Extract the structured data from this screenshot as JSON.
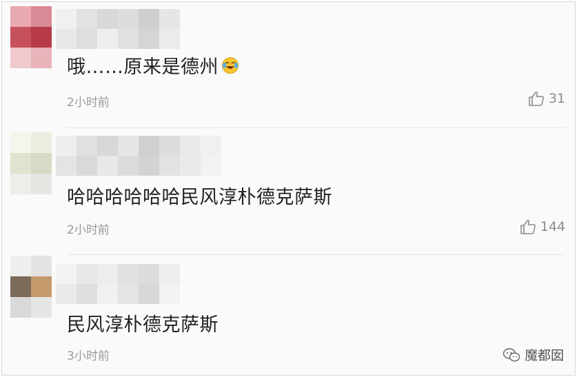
{
  "comments": [
    {
      "text": "哦……原来是德州",
      "emoji": "laughing-crying-emoji",
      "time": "2小时前",
      "likes": "31",
      "avatar_colors": [
        "#e9a9b0",
        "#d98a95",
        "#c6505c",
        "#b73a48",
        "#f0c9cd",
        "#e8b4ba"
      ],
      "username_colors": [
        [
          "#f0f0f0",
          "#e2e2e2",
          "#d8d8d8",
          "#dddddd",
          "#cfcfcf",
          "#e6e6e6"
        ],
        [
          "#e8e8e8",
          "#dedede",
          "#eeeeee",
          "#e0e0e0",
          "#d5d5d5",
          "#ebebeb"
        ]
      ]
    },
    {
      "text": "哈哈哈哈哈哈民风淳朴德克萨斯",
      "time": "2小时前",
      "likes": "144",
      "avatar_colors": [
        "#f4f5ec",
        "#eaeee0",
        "#dfe3cf",
        "#d5dbc4",
        "#eceeea",
        "#e4e6e2"
      ],
      "username_colors": [
        [
          "#eeeeee",
          "#e0e0e0",
          "#d7d7d7",
          "#e6e6e6",
          "#d0d0d0",
          "#dddddd",
          "#e9e9e9",
          "#f0f0f0"
        ],
        [
          "#e4e4e4",
          "#d9d9d9",
          "#e8e8e8",
          "#dcdcdc",
          "#d3d3d3",
          "#e2e2e2",
          "#eaeaea",
          "#f2f2f2"
        ]
      ]
    },
    {
      "text": "民风淳朴德克萨斯",
      "time": "3小时前",
      "avatar_colors": [
        "#efefef",
        "#e3e3e3",
        "#7c6a5a",
        "#c49a6c",
        "#d9d9d9",
        "#e6e6e6"
      ],
      "username_colors": [
        [
          "#f3f3f3",
          "#e8e8e8",
          "#ededed",
          "#e1e1e1",
          "#dcdcdc",
          "#eeeeee"
        ],
        [
          "#eaeaea",
          "#dfdfdf",
          "#f0f0f0",
          "#e4e4e4",
          "#d7d7d7",
          "#f2f2f2"
        ]
      ]
    }
  ],
  "watermark": {
    "text": "魔都囡",
    "icon": "wechat-icon"
  }
}
